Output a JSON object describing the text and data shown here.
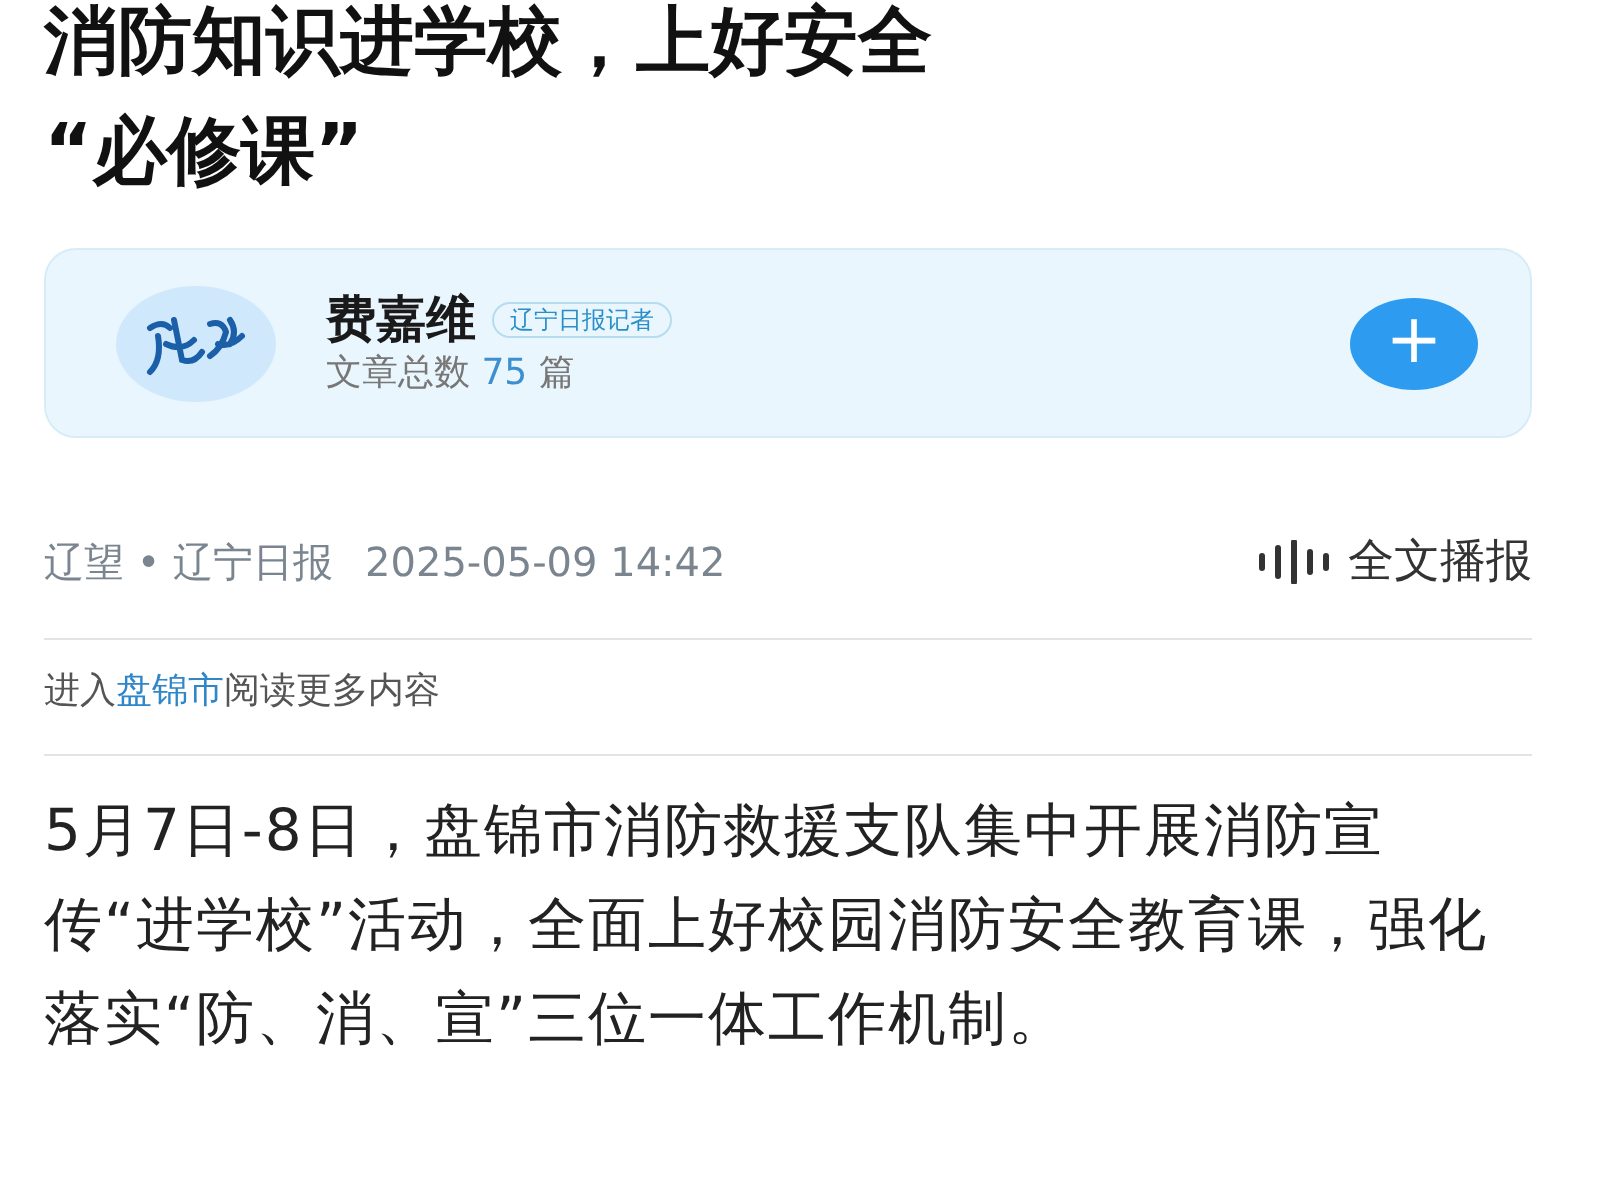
{
  "article": {
    "title_lines": [
      "消防知识进学校，上好安全",
      "“必修课”"
    ]
  },
  "author": {
    "name": "费嘉维",
    "badge": "辽宁日报记者",
    "count_label": "文章总数",
    "count": "75",
    "count_unit": "篇",
    "follow_label": "+"
  },
  "meta": {
    "source": "辽望 • 辽宁日报",
    "datetime": "2025-05-09 14:42",
    "listen": "全文播报"
  },
  "region_link": {
    "prefix": "进入",
    "link": "盘锦市",
    "suffix": "阅读更多内容"
  },
  "body": [
    "5月7日-8日，盘锦市消防救援支队集中开展消防宣传“进学校”活动，全面上好校园消防安全教育课，强化落实“防、消、宣”三位一体工作机制。"
  ]
}
